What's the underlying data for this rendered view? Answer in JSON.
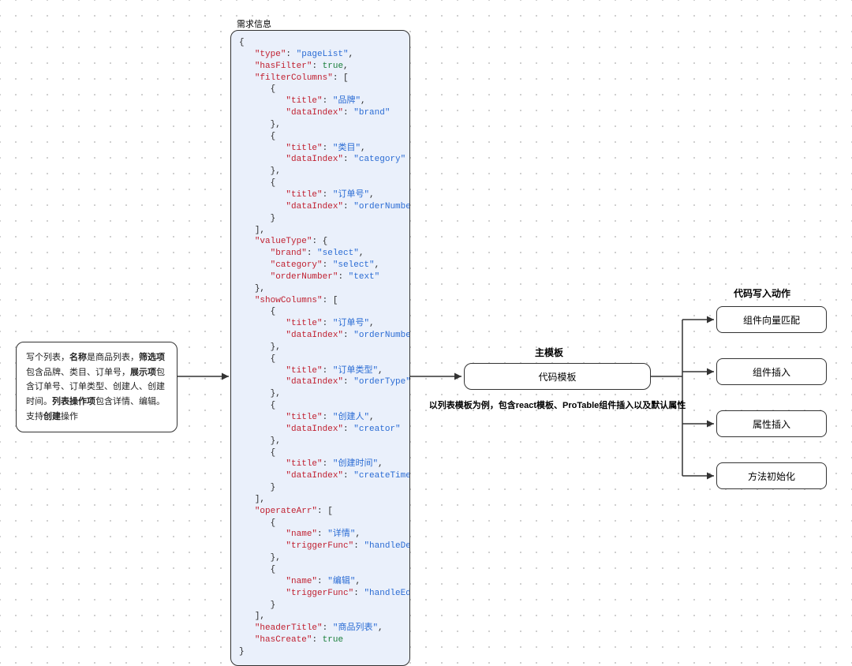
{
  "requirement": {
    "pre": "写个列表，",
    "b1": "名称",
    "t1": "是商品列表，",
    "b2": "筛选项",
    "t2": "包含品牌、类目、订单号，",
    "b3": "展示项",
    "t3": "包含订单号、订单类型、创建人、创建时间。",
    "b4": "列表操作项",
    "t4": "包含详情、编辑。支持",
    "b5": "创建",
    "t5": "操作"
  },
  "labels": {
    "json_title": "需求信息",
    "main_template_title": "主模板",
    "main_template_box": "代码模板",
    "main_template_sub": "以列表模板为例，包含react模板、ProTable组件插入以及默认属性",
    "actions_title": "代码写入动作",
    "actions": [
      "组件向量匹配",
      "组件插入",
      "属性插入",
      "方法初始化"
    ]
  },
  "json": {
    "type": "pageList",
    "hasFilter": true,
    "filterColumns": [
      {
        "title": "品牌",
        "dataIndex": "brand"
      },
      {
        "title": "类目",
        "dataIndex": "category"
      },
      {
        "title": "订单号",
        "dataIndex": "orderNumber"
      }
    ],
    "valueType": {
      "brand": "select",
      "category": "select",
      "orderNumber": "text"
    },
    "showColumns": [
      {
        "title": "订单号",
        "dataIndex": "orderNumber"
      },
      {
        "title": "订单类型",
        "dataIndex": "orderType"
      },
      {
        "title": "创建人",
        "dataIndex": "creator"
      },
      {
        "title": "创建时间",
        "dataIndex": "createTime"
      }
    ],
    "operateArr": [
      {
        "name": "详情",
        "triggerFunc": "handleDetail"
      },
      {
        "name": "编辑",
        "triggerFunc": "handleEdit"
      }
    ],
    "headerTitle": "商品列表",
    "hasCreate": true
  }
}
